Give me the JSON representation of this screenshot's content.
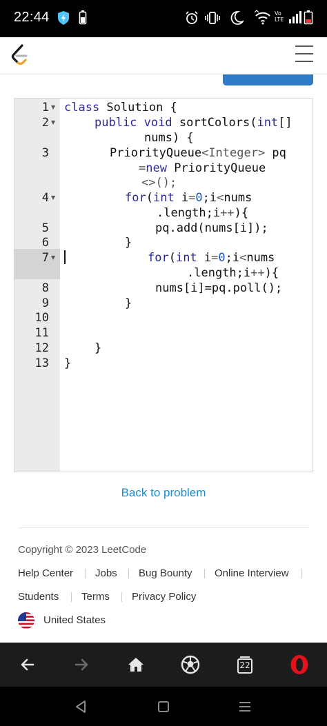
{
  "status": {
    "time": "22:44",
    "network_label_top": "Vo",
    "network_label_bottom": "LTE"
  },
  "header": {
    "logo_icon": "leetcode-logo-icon",
    "menu_icon": "hamburger-menu-icon"
  },
  "editor": {
    "lines": [
      {
        "num": "1",
        "fold": true
      },
      {
        "num": "2",
        "fold": true
      },
      {
        "num": "3",
        "fold": false
      },
      {
        "num": "4",
        "fold": true
      },
      {
        "num": "5",
        "fold": false
      },
      {
        "num": "6",
        "fold": false
      },
      {
        "num": "7",
        "fold": true
      },
      {
        "num": "8",
        "fold": false
      },
      {
        "num": "9",
        "fold": false
      },
      {
        "num": "10",
        "fold": false
      },
      {
        "num": "11",
        "fold": false
      },
      {
        "num": "12",
        "fold": false
      },
      {
        "num": "13",
        "fold": false
      }
    ],
    "code": {
      "l1a": "class",
      "l1b": " Solution {",
      "l2a": "public",
      "l2b": "void",
      "l2c": " sortColors(",
      "l2d": "int",
      "l2e": "[]",
      "l2f": "nums) {",
      "l3a": "PriorityQueue",
      "l3b": "<Integer>",
      "l3c": " pq",
      "l3d": "=",
      "l3e": "new",
      "l3f": " PriorityQueue",
      "l3g": "<>();",
      "l4a": "for",
      "l4b": "(",
      "l4c": "int",
      "l4d": " i",
      "l4e": "=",
      "l4f": "0",
      "l4g": ";i",
      "l4h": "<",
      "l4i": "nums",
      "l4j": ".length;i",
      "l4k": "++",
      "l4l": "){",
      "l5": "pq.add(nums[i]);",
      "l6": "}",
      "l7a": "for",
      "l7b": "(",
      "l7c": "int",
      "l7d": " i",
      "l7e": "=",
      "l7f": "0",
      "l7g": ";i",
      "l7h": "<",
      "l7i": "nums",
      "l7j": ".length;i",
      "l7k": "++",
      "l7l": "){",
      "l8": "nums[i]=pq.poll();",
      "l9": "}",
      "l12": "}",
      "l13": "}"
    }
  },
  "back_link": "Back to problem",
  "footer": {
    "copyright": "Copyright © 2023 LeetCode",
    "links_row1": [
      "Help Center",
      "Jobs",
      "Bug Bounty",
      "Online Interview"
    ],
    "links_row2": [
      "Students",
      "Terms",
      "Privacy Policy"
    ],
    "region": "United States",
    "region_icon": "us-flag-icon"
  },
  "browser_nav": {
    "tabs_count": "22",
    "icons": [
      "back-arrow-icon",
      "forward-arrow-icon",
      "home-icon",
      "soccer-ball-icon",
      "tabs-icon",
      "opera-icon"
    ]
  },
  "system_nav": {
    "icons": [
      "back-triangle-icon",
      "home-square-icon",
      "recents-icon"
    ]
  },
  "colors": {
    "link": "#1a8ccf",
    "accent_button": "#2f7bc6",
    "opera_red": "#e2111b"
  }
}
